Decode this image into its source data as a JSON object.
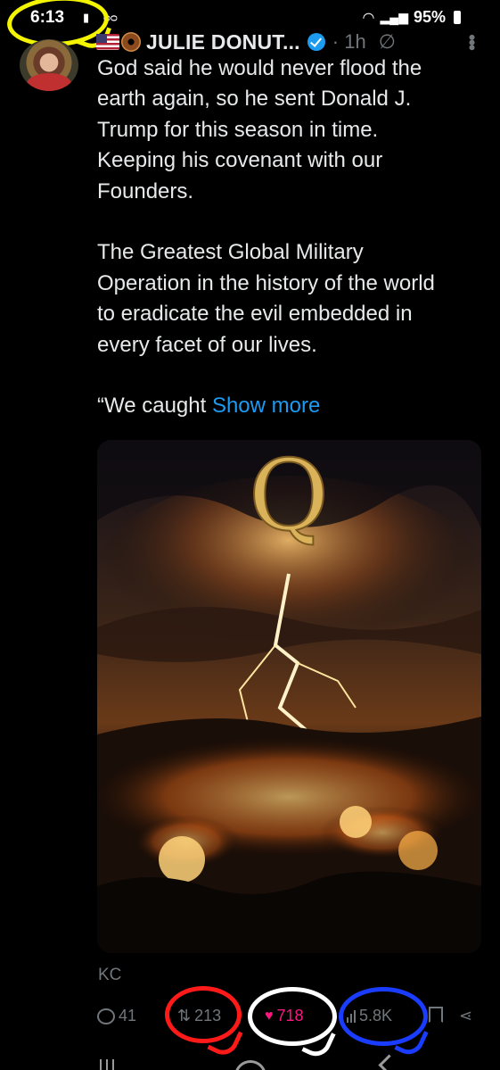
{
  "status_bar": {
    "time": "6:13",
    "voicemail_icon": "voicemail-icon",
    "battery": "95%"
  },
  "tweet": {
    "author_name": "JULIE DONUT...",
    "time_ago": "· 1h",
    "body_paragraph_1_lines": [
      "God said he would never flood the",
      "earth again, so he sent Donald J.",
      "Trump for this season in time.",
      "Keeping his covenant with our",
      "Founders."
    ],
    "body_paragraph_2_lines": [
      "The Greatest Global Military",
      "Operation in the history of the world",
      "to eradicate the evil embedded in",
      "every facet of our lives."
    ],
    "body_paragraph_3_prefix": "“We caught ",
    "show_more": "Show more",
    "image_letter": "Q",
    "caption": "KC",
    "actions": {
      "replies": "41",
      "retweets": "213",
      "likes": "718",
      "views": "5.8K"
    }
  },
  "colors": {
    "accent_blue": "#1d9bf0",
    "like_pink": "#f91880",
    "muted": "#71767b",
    "annotation_yellow": "#f4f400",
    "annotation_red": "#ff1a1a",
    "annotation_white": "#ffffff",
    "annotation_blue": "#1a3cff"
  }
}
